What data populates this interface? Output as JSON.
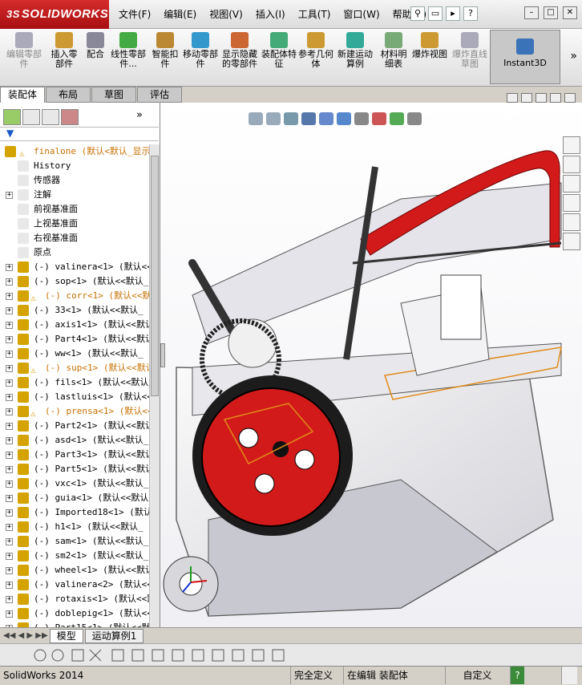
{
  "app": {
    "logo_text": "SOLIDWORKS",
    "logo_glyph": "3S",
    "menu": [
      "文件(F)",
      "编辑(E)",
      "视图(V)",
      "插入(I)",
      "工具(T)",
      "窗口(W)",
      "帮助(H)"
    ],
    "accent_red": "#c41e21",
    "part_red": "#d31a1a"
  },
  "toolbar": {
    "commands": [
      {
        "label": "编辑零部件",
        "disabled": true
      },
      {
        "label": "插入零部件",
        "disabled": false
      },
      {
        "label": "配合",
        "disabled": false
      },
      {
        "label": "线性零部件...",
        "disabled": false
      },
      {
        "label": "智能扣件",
        "disabled": false
      },
      {
        "label": "移动零部件",
        "disabled": false
      },
      {
        "label": "显示隐藏的零部件",
        "disabled": false
      },
      {
        "label": "装配体特征",
        "disabled": false
      },
      {
        "label": "参考几何体",
        "disabled": false
      },
      {
        "label": "新建运动算例",
        "disabled": false
      },
      {
        "label": "材料明细表",
        "disabled": false
      },
      {
        "label": "爆炸视图",
        "disabled": false
      },
      {
        "label": "爆炸直线草图",
        "disabled": true
      }
    ],
    "instant3d": "Instant3D",
    "more": "»"
  },
  "tabs": [
    "装配体",
    "布局",
    "草图",
    "评估"
  ],
  "feature_tree": {
    "root": "finalone (默认<默认_显示",
    "items": [
      {
        "text": "History",
        "icon": "history-icon",
        "expand": false
      },
      {
        "text": "传感器",
        "icon": "sensor-icon",
        "expand": false
      },
      {
        "text": "注解",
        "icon": "annotation-icon",
        "expand": true
      },
      {
        "text": "前视基准面",
        "icon": "plane-icon",
        "expand": false
      },
      {
        "text": "上视基准面",
        "icon": "plane-icon",
        "expand": false
      },
      {
        "text": "右视基准面",
        "icon": "plane-icon",
        "expand": false
      },
      {
        "text": "原点",
        "icon": "origin-icon",
        "expand": false
      },
      {
        "text": "(-) valinera<1> (默认<<默",
        "expand": true
      },
      {
        "text": "(-) sop<1> (默认<<默认_",
        "expand": true
      },
      {
        "text": "(-) corr<1> (默认<<默",
        "expand": true,
        "warn": true
      },
      {
        "text": "(-) 33<1> (默认<<默认_",
        "expand": true
      },
      {
        "text": "(-) axis1<1> (默认<<默认",
        "expand": true
      },
      {
        "text": "(-) Part4<1> (默认<<默认",
        "expand": true
      },
      {
        "text": "(-) ww<1> (默认<<默认_",
        "expand": true
      },
      {
        "text": "(-) sup<1> (默认<<默认",
        "expand": true,
        "warn": true
      },
      {
        "text": "(-) fils<1> (默认<<默认_",
        "expand": true
      },
      {
        "text": "(-) lastluis<1> (默认<<默",
        "expand": true
      },
      {
        "text": "(-) prensa<1> (默认<<",
        "expand": true,
        "warn": true
      },
      {
        "text": "(-) Part2<1> (默认<<默认",
        "expand": true
      },
      {
        "text": "(-) asd<1> (默认<<默认_",
        "expand": true
      },
      {
        "text": "(-) Part3<1> (默认<<默认",
        "expand": true
      },
      {
        "text": "(-) Part5<1> (默认<<默认",
        "expand": true
      },
      {
        "text": "(-) vxc<1> (默认<<默认_",
        "expand": true
      },
      {
        "text": "(-) guia<1> (默认<<默认",
        "expand": true
      },
      {
        "text": "(-) Imported18<1> (默认<",
        "expand": true
      },
      {
        "text": "(-) h1<1> (默认<<默认_",
        "expand": true
      },
      {
        "text": "(-) sam<1> (默认<<默认_",
        "expand": true
      },
      {
        "text": "(-) sm2<1> (默认<<默认_",
        "expand": true
      },
      {
        "text": "(-) wheel<1> (默认<<默认",
        "expand": true
      },
      {
        "text": "(-) valinera<2> (默认<<默",
        "expand": true
      },
      {
        "text": "(-) rotaxis<1> (默认<<默",
        "expand": true
      },
      {
        "text": "(-) doblepig<1> (默认<<",
        "expand": true
      },
      {
        "text": "(-) Part15<1> (默认<<默",
        "expand": true
      }
    ]
  },
  "bottom_tabs": [
    "模型",
    "运动算例1"
  ],
  "status": {
    "app": "SolidWorks 2014",
    "definition": "完全定义",
    "editing": "在编辑 装配体",
    "custom": "自定义",
    "help": "?"
  }
}
